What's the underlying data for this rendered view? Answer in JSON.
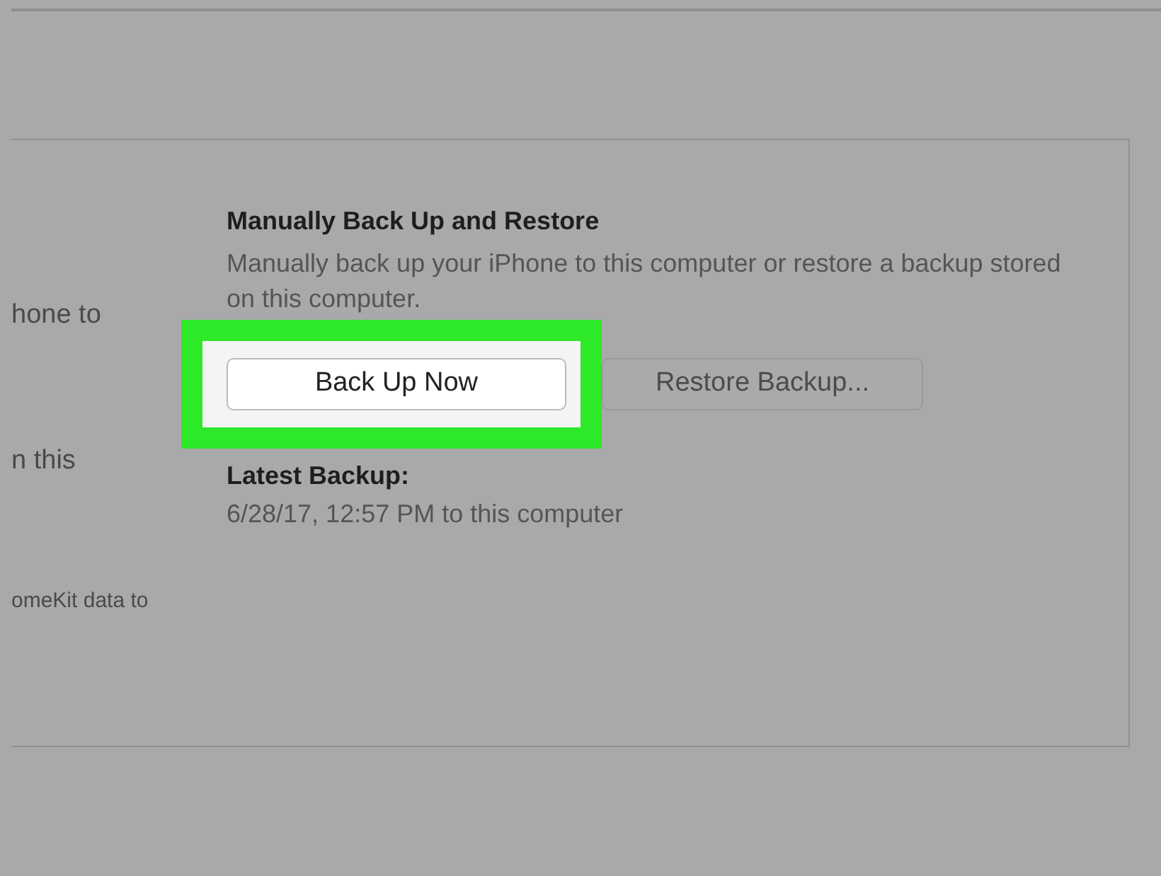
{
  "left_column": [
    "hone to",
    "n this",
    "omeKit data to"
  ],
  "manual_backup": {
    "title": "Manually Back Up and Restore",
    "description": "Manually back up your iPhone to this computer or restore a backup stored on this computer.",
    "buttons": [
      {
        "label": "Back Up Now",
        "highlighted": true
      },
      {
        "label": "Restore Backup...",
        "highlighted": false
      }
    ]
  },
  "latest_backup": {
    "label": "Latest Backup:",
    "value": "6/28/17, 12:57 PM to this computer"
  }
}
